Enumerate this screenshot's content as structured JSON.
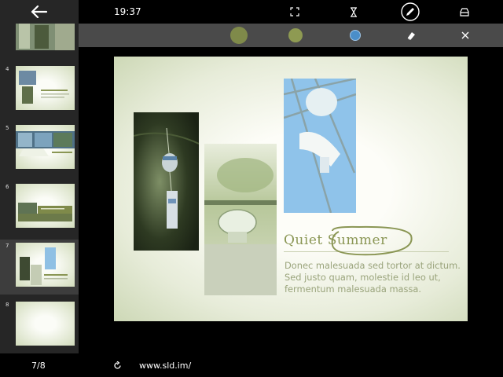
{
  "status": {
    "time": "19:37"
  },
  "topbar": {
    "icons": [
      "fullscreen-icon",
      "hourglass-icon",
      "pen-icon",
      "eraser-icon"
    ]
  },
  "toolbar": {
    "colors": [
      "#7f8a4a",
      "#8e9a52",
      "#4a8ec9"
    ],
    "icons": [
      "eraser-icon",
      "close-icon"
    ]
  },
  "sidebar": {
    "back_icon": "back-arrow-icon",
    "slides": [
      {
        "number": ""
      },
      {
        "number": "4"
      },
      {
        "number": "5"
      },
      {
        "number": "6"
      },
      {
        "number": "7",
        "selected": true
      },
      {
        "number": "8"
      }
    ]
  },
  "slide": {
    "title_left": "Quiet",
    "title_right": "Summer",
    "body": "Donec malesuada sed tortor at dictum. Sed justo quam, molestie id leo ut, fermentum malesuada massa."
  },
  "bottom": {
    "page": "7/8",
    "url": "www.sld.im/"
  }
}
